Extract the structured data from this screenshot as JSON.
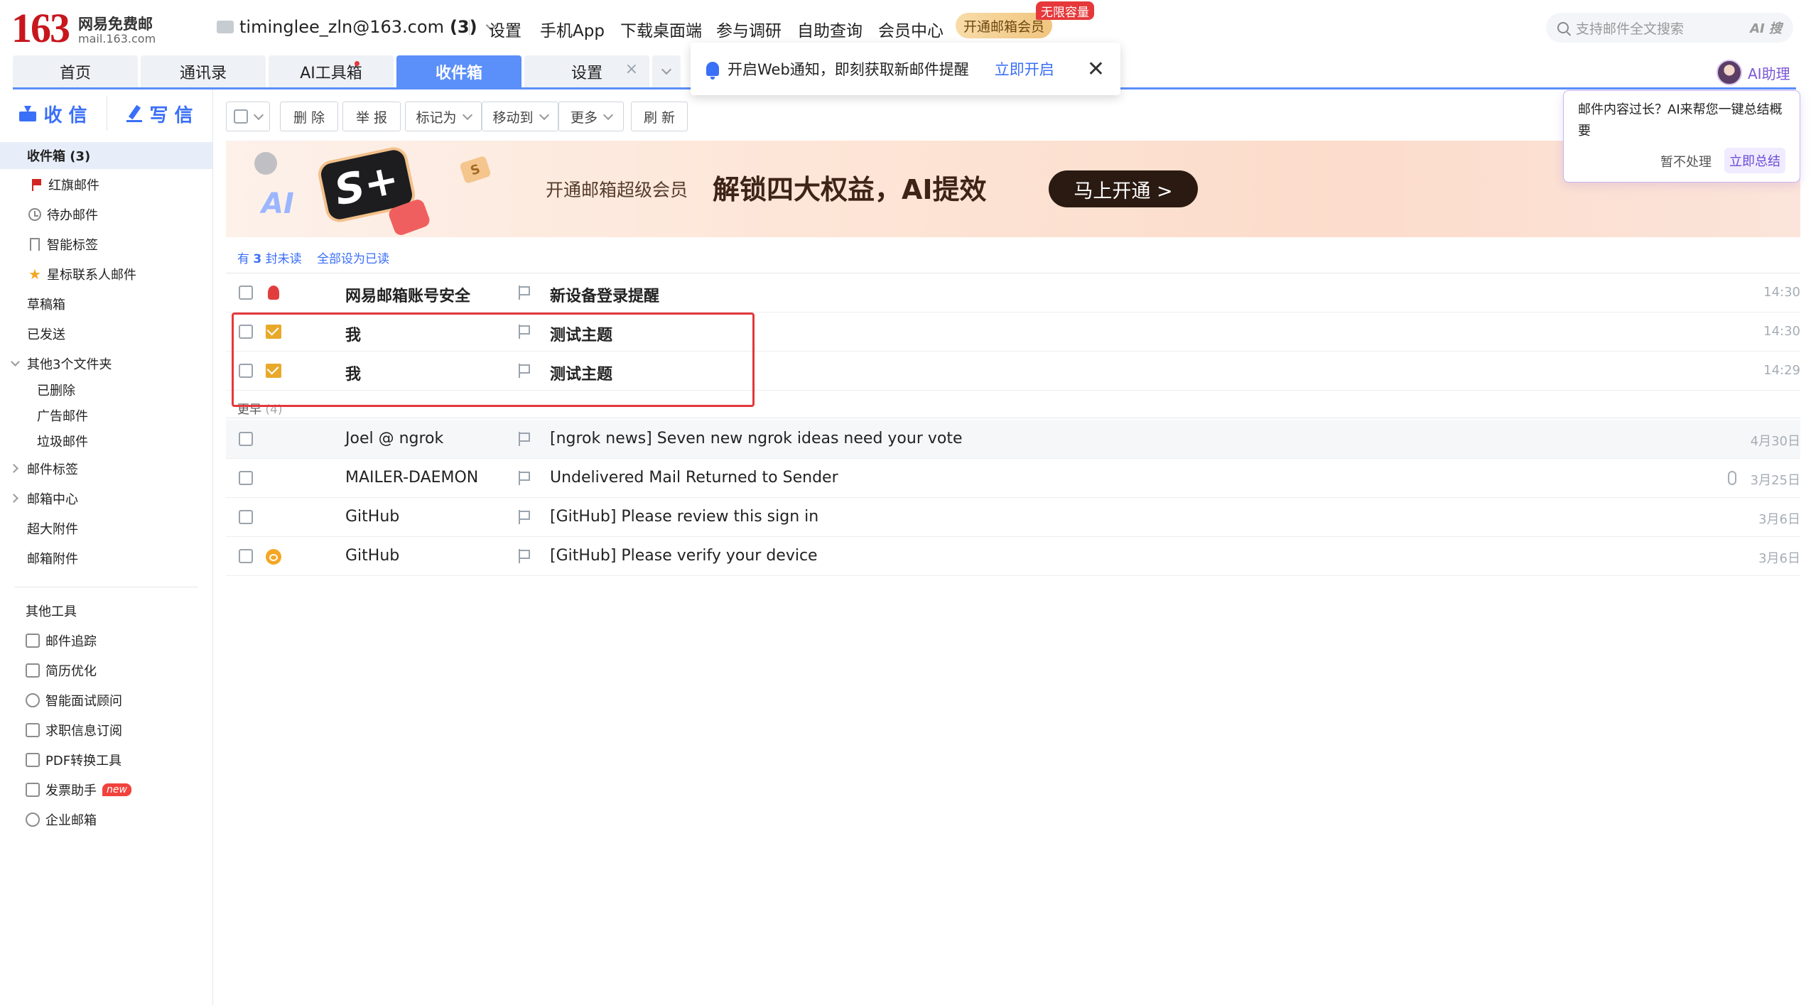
{
  "header": {
    "logo_number": "163",
    "logo_text": "网易免费邮",
    "logo_domain": "mail.163.com",
    "account": "timinglee_zln@163.com",
    "account_unread": "(3)",
    "nav_links": [
      "设置",
      "手机App",
      "下载桌面端",
      "参与调研",
      "自助查询",
      "会员中心"
    ],
    "vip_button": "开通邮箱会员",
    "vip_badge": "无限容量",
    "search_placeholder": "支持邮件全文搜索",
    "search_ai": "AI 搜"
  },
  "tabs": [
    {
      "label": "首页"
    },
    {
      "label": "通讯录"
    },
    {
      "label": "AI工具箱"
    },
    {
      "label": "收件箱"
    },
    {
      "label": "设置"
    }
  ],
  "notification": {
    "text": "开启Web通知，即刻获取新邮件提醒",
    "link": "立即开启",
    "close": "✕"
  },
  "ai_assistant": {
    "label": "AI助理",
    "popup_text": "邮件内容过长？AI来帮您一键总结概要",
    "dismiss": "暂不处理",
    "confirm": "立即总结"
  },
  "sidebar": {
    "receive": "收 信",
    "compose": "写 信",
    "folders": [
      {
        "label": "收件箱 (3)"
      },
      {
        "label": "红旗邮件"
      },
      {
        "label": "待办邮件"
      },
      {
        "label": "智能标签"
      },
      {
        "label": "星标联系人邮件"
      },
      {
        "label": "草稿箱"
      },
      {
        "label": "已发送"
      },
      {
        "label": "其他3个文件夹"
      },
      {
        "label": "已删除"
      },
      {
        "label": "广告邮件"
      },
      {
        "label": "垃圾邮件"
      },
      {
        "label": "邮件标签"
      },
      {
        "label": "邮箱中心"
      },
      {
        "label": "超大附件"
      },
      {
        "label": "邮箱附件"
      }
    ],
    "tools_title": "其他工具",
    "tools": [
      {
        "label": "邮件追踪",
        "icon": "mail-track-icon"
      },
      {
        "label": "简历优化",
        "icon": "resume-icon"
      },
      {
        "label": "智能面试顾问",
        "icon": "interview-icon"
      },
      {
        "label": "求职信息订阅",
        "icon": "job-subscribe-icon"
      },
      {
        "label": "PDF转换工具",
        "icon": "pdf-icon"
      },
      {
        "label": "发票助手",
        "icon": "invoice-icon",
        "badge": "new"
      },
      {
        "label": "企业邮箱",
        "icon": "globe-icon"
      }
    ]
  },
  "toolbar": {
    "delete": "删 除",
    "report": "举 报",
    "mark_as": "标记为",
    "move_to": "移动到",
    "more": "更多",
    "refresh": "刷 新"
  },
  "banner": {
    "subtitle": "开通邮箱超级会员",
    "headline": "解锁四大权益，AI提效",
    "cta": "马上开通 >",
    "logo_mark": "S+",
    "ai_mark": "AI",
    "coin_mark": "S"
  },
  "unread_info": {
    "prefix": "有",
    "count": "3",
    "suffix": "封未读",
    "mark_all": "全部设为已读"
  },
  "groups": {
    "earlier": "更早",
    "earlier_count": "(4)"
  },
  "emails": [
    {
      "from": "网易邮箱账号安全",
      "subject": "新设备登录提醒",
      "time": "14:30",
      "unread": true,
      "status_icon": "security-alert-icon"
    },
    {
      "from": "我",
      "subject": "测试主题",
      "time": "14:30",
      "unread": true,
      "status_icon": "envelope-icon"
    },
    {
      "from": "我",
      "subject": "测试主题",
      "time": "14:29",
      "unread": true,
      "status_icon": "envelope-icon"
    },
    {
      "from": "Joel @ ngrok",
      "subject": "[ngrok news] Seven new ngrok ideas need your vote",
      "time": "4月30日",
      "unread": false
    },
    {
      "from": "MAILER-DAEMON",
      "subject": "Undelivered Mail Returned to Sender",
      "time": "3月25日",
      "unread": false,
      "attachment": true
    },
    {
      "from": "GitHub",
      "subject": "[GitHub] Please review this sign in",
      "time": "3月6日",
      "unread": false
    },
    {
      "from": "GitHub",
      "subject": "[GitHub] Please verify your device",
      "time": "3月6日",
      "unread": false,
      "status_icon": "key-icon"
    }
  ],
  "colors": {
    "accent": "#3a6ff7",
    "tab_active": "#5b8ff9",
    "logo_red": "#c8161d",
    "highlight_red": "#e5383b"
  }
}
